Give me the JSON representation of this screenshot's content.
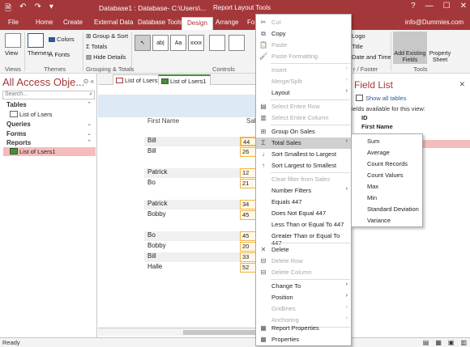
{
  "titlebar": {
    "qat": [
      "🗎",
      "↶",
      "↷",
      "▾"
    ],
    "title": "Database1 : Database- C:\\Users\\...",
    "context_title": "Report Layout Tools",
    "win_buttons": [
      "?",
      "—",
      "☐",
      "✕"
    ]
  },
  "tabs": {
    "items": [
      "File",
      "Home",
      "Create",
      "External Data",
      "Database Tools",
      "Design",
      "Arrange",
      "Fo"
    ],
    "active": "Design",
    "user": "info@Dummies.com"
  },
  "ribbon": {
    "view_label": "View",
    "themes_label": "Themes",
    "colors_label": "Colors",
    "fonts_label": "Fonts",
    "group_sort_label": "Group & Sort",
    "totals_label": "Totals",
    "hide_details_label": "Hide Details",
    "controls_items": [
      "↖",
      "ab|",
      "Aa",
      "xxxx",
      "",
      ""
    ],
    "logo_label": "Logo",
    "title_label": "Title",
    "date_time_label": "Date and Time",
    "add_fields_label": "Add Existing Fields",
    "property_sheet_label": "Property Sheet",
    "groups": [
      "Views",
      "Themes",
      "Grouping & Totals",
      "Controls",
      "r / Footer",
      "Tools"
    ]
  },
  "navpane": {
    "header": "All Access Obje...",
    "header_buttons": [
      "«",
      "⊙"
    ],
    "search_placeholder": "Search...",
    "search_icon": "⌕",
    "sections": [
      {
        "label": "Tables",
        "chevron": "⌃",
        "items": [
          "List of Lsers"
        ]
      },
      {
        "label": "Queries",
        "chevron": "⌄",
        "items": []
      },
      {
        "label": "Forms",
        "chevron": "⌄",
        "items": []
      },
      {
        "label": "Reports",
        "chevron": "⌃",
        "items": [
          "List of Lsers1"
        ]
      }
    ]
  },
  "doctabs": [
    "List of Lsers",
    "List of Lsers1"
  ],
  "report": {
    "header_first": "First Name",
    "header_sales": "Sal",
    "rows": [
      {
        "name": "Bill",
        "sales": "44"
      },
      {
        "name": "Bill",
        "sales": "26"
      },
      {
        "name": "Patrick",
        "sales": "12"
      },
      {
        "name": "Bo",
        "sales": "21"
      },
      {
        "name": "Patrick",
        "sales": "34"
      },
      {
        "name": "Bobby",
        "sales": "45"
      },
      {
        "name": "Bo",
        "sales": "45"
      },
      {
        "name": "Bobby",
        "sales": "20"
      },
      {
        "name": "Bill",
        "sales": "33"
      },
      {
        "name": "Halle",
        "sales": "52"
      }
    ]
  },
  "context_menu": [
    {
      "label": "Cut",
      "icon": "✂",
      "disabled": true
    },
    {
      "label": "Copy",
      "icon": "⧉",
      "disabled": false
    },
    {
      "label": "Paste",
      "icon": "📋",
      "disabled": true
    },
    {
      "label": "Paste Formatting",
      "icon": "🖌",
      "disabled": true
    },
    {
      "label": "Insert",
      "arrow": "›",
      "disabled": true
    },
    {
      "label": "Merge/Split",
      "arrow": "›",
      "disabled": true
    },
    {
      "label": "Layout",
      "arrow": "›",
      "disabled": false
    },
    {
      "label": "Select Entire Row",
      "icon": "▤",
      "disabled": true
    },
    {
      "label": "Select Entire Column",
      "icon": "▥",
      "disabled": true
    },
    {
      "label": "Group On Sales",
      "icon": "⊞",
      "disabled": false
    },
    {
      "label": "Total Sales",
      "icon": "Σ",
      "arrow": "›",
      "disabled": false,
      "highlighted": true
    },
    {
      "label": "Sort Smallest to Largest",
      "icon": "↓",
      "disabled": false
    },
    {
      "label": "Sort Largest to Smallest",
      "icon": "↑",
      "disabled": false
    },
    {
      "label": "Clear filter from Sales",
      "disabled": true
    },
    {
      "label": "Number Filters",
      "arrow": "›",
      "disabled": false
    },
    {
      "label": "Equals 447",
      "disabled": false
    },
    {
      "label": "Does Not Equal 447",
      "disabled": false
    },
    {
      "label": "Less Than or Equal To 447",
      "disabled": false
    },
    {
      "label": "Greater Than or Equal To 447",
      "disabled": false
    },
    {
      "label": "Delete",
      "icon": "✕",
      "disabled": false
    },
    {
      "label": "Delete Row",
      "icon": "⊟",
      "disabled": true
    },
    {
      "label": "Delete Column",
      "icon": "⊟",
      "disabled": true
    },
    {
      "label": "Change To",
      "arrow": "›",
      "disabled": false
    },
    {
      "label": "Position",
      "arrow": "›",
      "disabled": false
    },
    {
      "label": "Gridlines",
      "arrow": "›",
      "disabled": true
    },
    {
      "label": "Anchoring",
      "arrow": "›",
      "disabled": true
    },
    {
      "label": "Report Properties",
      "icon": "▦",
      "disabled": false
    },
    {
      "label": "Properties",
      "icon": "▦",
      "disabled": false
    }
  ],
  "submenu": [
    "Sum",
    "Average",
    "Count Records",
    "Count Values",
    "Max",
    "Min",
    "Standard Deviation",
    "Variance"
  ],
  "fieldlist": {
    "title": "Field List",
    "close": "✕",
    "show_all": "Show all tables",
    "available": "ields available for this view:",
    "fields": [
      "ID",
      "First Name"
    ]
  },
  "statusbar": {
    "ready": "Ready",
    "view_icons": [
      "▤",
      "▦",
      "▣",
      "▥"
    ]
  },
  "colors": {
    "accent": "#a4373a",
    "selection": "#f5bcbc",
    "report_icon": "#4a8d3e"
  }
}
